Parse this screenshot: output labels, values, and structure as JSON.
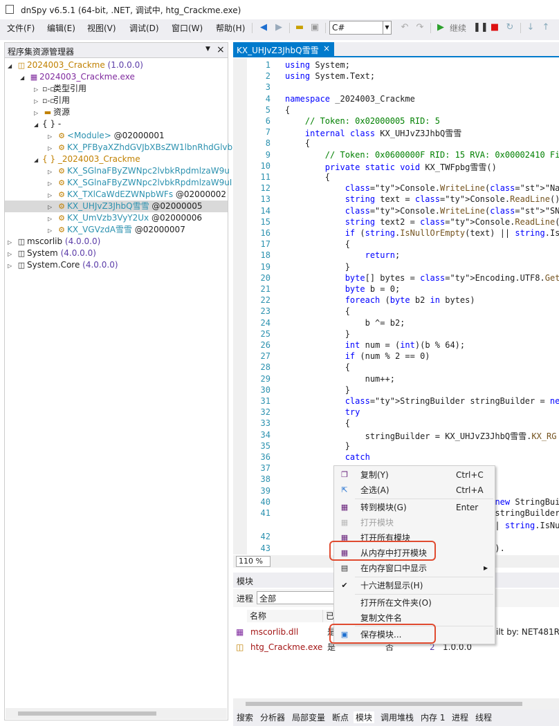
{
  "window": {
    "title": "dnSpy v6.5.1 (64-bit, .NET, 调试中, htg_Crackme.exe)"
  },
  "menu": [
    "文件(F)",
    "编辑(E)",
    "视图(V)",
    "调试(D)",
    "窗口(W)",
    "帮助(H)"
  ],
  "toolbar": {
    "language": "C#",
    "continue_label": "继续"
  },
  "explorer": {
    "title": "程序集资源管理器",
    "nodes": [
      {
        "name": "2024003_Crackme",
        "suffix": " (1.0.0.0)"
      },
      {
        "name": "2024003_Crackme.exe"
      },
      {
        "name": "类型引用"
      },
      {
        "name": "引用"
      },
      {
        "name": "资源"
      },
      {
        "name": "{ } -"
      },
      {
        "name": "<Module>",
        "suffix": " @02000001"
      },
      {
        "name": "KX_PFByaXZhdGVJbXBsZW1lbnRhdGlvbkR"
      },
      {
        "name": "{ } _2024003_Crackme"
      },
      {
        "name": "KX_SGlnaFByZWNpc2lvbkRpdmlzaW9u"
      },
      {
        "name": "KX_SGlnaFByZWNpc2lvbkRpdmlzaW9uI"
      },
      {
        "name": "KX_TXlCaWdEZWNpbWFs",
        "suffix": " @02000002"
      },
      {
        "name": "KX_UHJvZ3JhbQ雪雪",
        "suffix": " @02000005"
      },
      {
        "name": "KX_UmVzb3VyY2Ux",
        "suffix": " @02000006"
      },
      {
        "name": "KX_VGVzdA雪雪",
        "suffix": " @02000007"
      },
      {
        "name": "mscorlib",
        "suffix": " (4.0.0.0)"
      },
      {
        "name": "System",
        "suffix": " (4.0.0.0)"
      },
      {
        "name": "System.Core",
        "suffix": " (4.0.0.0)"
      }
    ]
  },
  "editor": {
    "tab": "KX_UHJvZ3JhbQ雪雪",
    "zoom": "110 %",
    "lines": [
      {
        "n": "1",
        "t": "using System;"
      },
      {
        "n": "2",
        "t": "using System.Text;"
      },
      {
        "n": "3",
        "t": ""
      },
      {
        "n": "4",
        "t": "namespace _2024003_Crackme"
      },
      {
        "n": "5",
        "t": "{"
      },
      {
        "n": "6",
        "t": "    // Token: 0x02000005 RID: 5"
      },
      {
        "n": "7",
        "t": "    internal class KX_UHJvZ3JhbQ雪雪"
      },
      {
        "n": "8",
        "t": "    {"
      },
      {
        "n": "9",
        "t": "        // Token: 0x0600000F RID: 15 RVA: 0x00002410 File"
      },
      {
        "n": "10",
        "t": "        private static void KX_TWFpbg雪雪()"
      },
      {
        "n": "11",
        "t": "        {"
      },
      {
        "n": "12",
        "t": "            Console.WriteLine(\"Name:\");"
      },
      {
        "n": "13",
        "t": "            string text = Console.ReadLine();"
      },
      {
        "n": "14",
        "t": "            Console.WriteLine(\"SN: \");"
      },
      {
        "n": "15",
        "t": "            string text2 = Console.ReadLine();"
      },
      {
        "n": "16",
        "t": "            if (string.IsNullOrEmpty(text) || string.IsN"
      },
      {
        "n": "17",
        "t": "            {"
      },
      {
        "n": "18",
        "t": "                return;"
      },
      {
        "n": "19",
        "t": "            }"
      },
      {
        "n": "20",
        "t": "            byte[] bytes = Encoding.UTF8.GetBytes(text)"
      },
      {
        "n": "21",
        "t": "            byte b = 0;"
      },
      {
        "n": "22",
        "t": "            foreach (byte b2 in bytes)"
      },
      {
        "n": "23",
        "t": "            {"
      },
      {
        "n": "24",
        "t": "                b ^= b2;"
      },
      {
        "n": "25",
        "t": "            }"
      },
      {
        "n": "26",
        "t": "            int num = (int)(b % 64);"
      },
      {
        "n": "27",
        "t": "            if (num % 2 == 0)"
      },
      {
        "n": "28",
        "t": "            {"
      },
      {
        "n": "29",
        "t": "                num++;"
      },
      {
        "n": "30",
        "t": "            }"
      },
      {
        "n": "31",
        "t": "            StringBuilder stringBuilder = new StringBuil"
      },
      {
        "n": "32",
        "t": "            try"
      },
      {
        "n": "33",
        "t": "            {"
      },
      {
        "n": "34",
        "t": "                stringBuilder = KX_UHJvZ3JhbQ雪雪.KX_RG"
      },
      {
        "n": "35",
        "t": "            }"
      },
      {
        "n": "36",
        "t": "            catch"
      },
      {
        "n": "37",
        "t": ""
      },
      {
        "n": "38",
        "t": ""
      },
      {
        "n": "39",
        "t": ""
      },
      {
        "n": "40",
        "t": "                                          new StringBui"
      },
      {
        "n": "41",
        "t": "                                          stringBuilder"
      },
      {
        "n": "",
        "t": "                                          | string.IsNu"
      },
      {
        "n": "42",
        "t": ""
      },
      {
        "n": "43",
        "t": "                                          )."
      }
    ]
  },
  "modules": {
    "title": "模块",
    "process_label": "进程",
    "process_value": "全部",
    "columns": [
      "名称",
      "已"
    ],
    "rows": [
      {
        "name": "mscorlib.dll",
        "col2": "是",
        "tail": "ilt by: NET481RE"
      },
      {
        "name": "htg_Crackme.exe",
        "col2": "是",
        "col3": "否",
        "col4": "否",
        "col5": "2",
        "col6": "1.0.0.0"
      }
    ]
  },
  "bottom_tabs": [
    "搜索",
    "分析器",
    "局部变量",
    "断点",
    "模块",
    "调用堆栈",
    "内存 1",
    "进程",
    "线程"
  ],
  "context_menu": [
    {
      "label": "复制(Y)",
      "shortcut": "Ctrl+C",
      "icon": "copy-icon"
    },
    {
      "label": "全选(A)",
      "shortcut": "Ctrl+A",
      "icon": "select-all-icon"
    },
    {
      "label": "转到模块(G)",
      "shortcut": "Enter",
      "icon": "module-icon"
    },
    {
      "label": "打开模块",
      "shortcut": "",
      "icon": "module-icon",
      "disabled": true
    },
    {
      "label": "打开所有模块",
      "shortcut": "",
      "icon": "module-icon"
    },
    {
      "label": "从内存中打开模块",
      "shortcut": "",
      "icon": "module-icon",
      "highlight": true
    },
    {
      "label": "在内存窗口中显示",
      "shortcut": "",
      "icon": "memory-icon",
      "submenu": true
    },
    {
      "label": "十六进制显示(H)",
      "shortcut": "",
      "icon": "check-icon"
    },
    {
      "label": "打开所在文件夹(O)",
      "shortcut": "",
      "icon": ""
    },
    {
      "label": "复制文件名",
      "shortcut": "",
      "icon": ""
    },
    {
      "label": "保存模块...",
      "shortcut": "",
      "icon": "save-icon",
      "highlight": true
    }
  ]
}
